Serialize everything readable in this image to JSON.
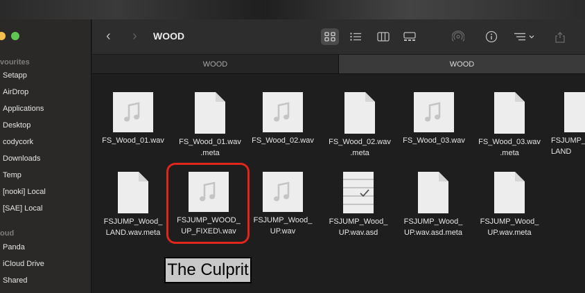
{
  "window": {
    "title": "WOOD"
  },
  "tabs": [
    {
      "label": "WOOD"
    },
    {
      "label": "WOOD"
    }
  ],
  "sidebar": {
    "favourites_label": "vourites",
    "favourites": [
      {
        "label": "Setapp"
      },
      {
        "label": "AirDrop"
      },
      {
        "label": "Applications"
      },
      {
        "label": "Desktop"
      },
      {
        "label": "codycork"
      },
      {
        "label": "Downloads"
      },
      {
        "label": "Temp"
      },
      {
        "label": "[nooki] Local"
      },
      {
        "label": "[SAE] Local"
      }
    ],
    "icloud_label": "oud",
    "icloud": [
      {
        "label": "Panda"
      },
      {
        "label": "iCloud Drive"
      },
      {
        "label": "Shared"
      }
    ]
  },
  "files": [
    {
      "name": "FS_Wood_01.wav",
      "icon": "audio-file-icon"
    },
    {
      "name": "FS_Wood_01.wav\n.meta",
      "icon": "document-icon"
    },
    {
      "name": "FS_Wood_02.wav",
      "icon": "audio-file-icon"
    },
    {
      "name": "FS_Wood_02.wav\n.meta",
      "icon": "document-icon"
    },
    {
      "name": "FS_Wood_03.wav",
      "icon": "audio-file-icon"
    },
    {
      "name": "FS_Wood_03.wav\n.meta",
      "icon": "document-icon"
    },
    {
      "name": "FSJUMP_\nLAND",
      "icon": "audio-file-icon"
    },
    {
      "name": "FSJUMP_Wood_\nLAND.wav.meta",
      "icon": "document-icon"
    },
    {
      "name": "FSJUMP_WOOD_\nUP_FIXED\\.wav",
      "icon": "audio-file-icon"
    },
    {
      "name": "FSJUMP_Wood_\nUP.wav",
      "icon": "audio-file-icon"
    },
    {
      "name": "FSJUMP_Wood_\nUP.wav.asd",
      "icon": "checklist-document-icon"
    },
    {
      "name": "FSJUMP_Wood_\nUP.wav.asd.meta",
      "icon": "document-icon"
    },
    {
      "name": "FSJUMP_Wood_\nUP.wav.meta",
      "icon": "document-icon"
    }
  ],
  "annotation": {
    "text": "The Culprit",
    "color": "#e0251b"
  }
}
